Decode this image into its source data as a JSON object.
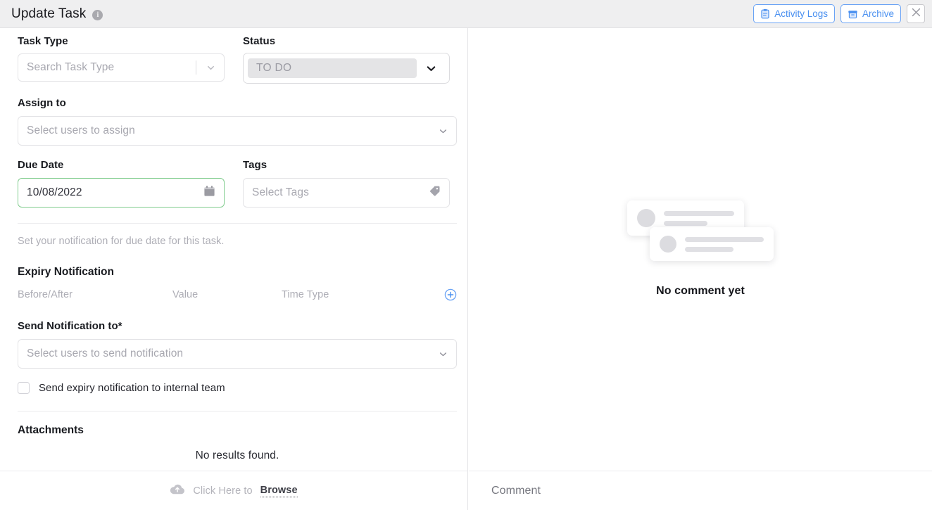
{
  "header": {
    "title": "Update Task",
    "info_icon": "info-icon",
    "activity_logs_label": "Activity Logs",
    "activity_logs_icon": "clipboard-icon",
    "archive_label": "Archive",
    "archive_icon": "archive-box-icon",
    "close_icon": "close-icon",
    "accent_blue": "#4a90f0",
    "background": "#efeff0"
  },
  "form": {
    "task_type": {
      "label": "Task Type",
      "placeholder": "Search Task Type",
      "value": ""
    },
    "status": {
      "label": "Status",
      "value": "TO DO",
      "pill_background": "#e4e4e6"
    },
    "assign_to": {
      "label": "Assign to",
      "placeholder": "Select users to assign",
      "value": ""
    },
    "due_date": {
      "label": "Due Date",
      "value": "10/08/2022",
      "icon": "calendar-icon",
      "border_color": "#82cd8f"
    },
    "tags": {
      "label": "Tags",
      "placeholder": "Select Tags",
      "value": "",
      "icon": "tag-icon"
    },
    "hint": "Set your notification for due date for this task.",
    "expiry_notification": {
      "title": "Expiry Notification",
      "columns": [
        "Before/After",
        "Value",
        "Time Type"
      ],
      "add_icon": "plus-circle-icon",
      "rows": []
    },
    "send_notification": {
      "label": "Send Notification to*",
      "placeholder": "Select users to send notification",
      "value": ""
    },
    "internal_team_checkbox": {
      "label": "Send expiry notification to internal team",
      "checked": false
    },
    "attachments": {
      "title": "Attachments",
      "empty_text": "No results found."
    },
    "upload": {
      "icon": "cloud-upload-icon",
      "text": "Click Here to",
      "browse_label": "Browse"
    }
  },
  "comments": {
    "empty_text": "No comment yet",
    "empty_illustration": "comment-cards-illustration",
    "input_placeholder": "Comment"
  }
}
